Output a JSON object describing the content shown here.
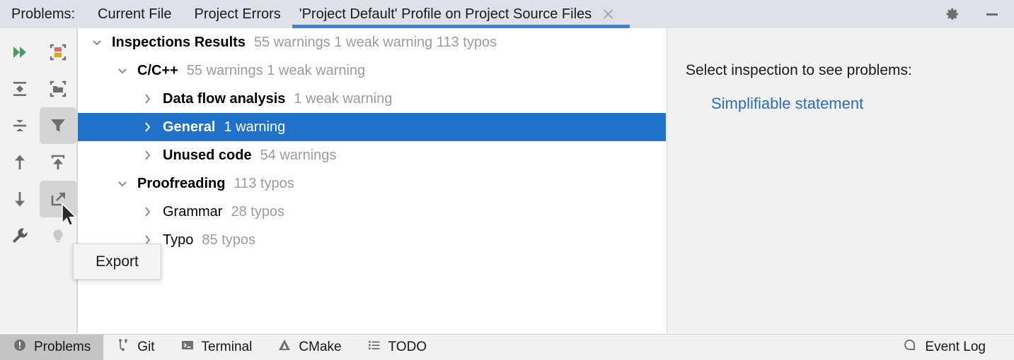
{
  "window": {
    "tab_group_label": "Problems:",
    "tabs": [
      {
        "label": "Current File",
        "active": false,
        "closable": false
      },
      {
        "label": "Project Errors",
        "active": false,
        "closable": false
      },
      {
        "label": "'Project Default' Profile on Project Source Files",
        "active": true,
        "closable": true
      }
    ],
    "accent_color": "#3f84cd",
    "titlebar_bg": "#dfe1e8",
    "controls": [
      {
        "name": "gear-icon",
        "title": "Settings"
      },
      {
        "name": "minimize-icon",
        "title": "Hide"
      }
    ]
  },
  "toolbar": {
    "buttons": [
      {
        "name": "rerun-icon",
        "title": "Rerun Inspection",
        "selected": false
      },
      {
        "name": "collapse-groups-icon",
        "title": "Group by Severity",
        "selected": false
      },
      {
        "name": "expand-all-icon",
        "title": "Expand All",
        "selected": false
      },
      {
        "name": "collapse-all-icon",
        "title": "Collapse All",
        "selected": false
      },
      {
        "name": "filter-icon",
        "title": "Filter",
        "selected": true
      },
      {
        "name": "previous-problem-icon",
        "title": "Previous Problem",
        "selected": false
      },
      {
        "name": "apply-fix-icon",
        "title": "Apply Quick Fix",
        "selected": false
      },
      {
        "name": "next-problem-icon",
        "title": "Next Problem",
        "selected": false
      },
      {
        "name": "export-icon",
        "title": "Export",
        "selected": true
      },
      {
        "name": "settings-wrench-icon",
        "title": "Edit Settings",
        "selected": false
      },
      {
        "name": "lightbulb-icon",
        "title": "Suggestions",
        "selected": false
      }
    ]
  },
  "tooltip": {
    "visible": true,
    "text": "Export"
  },
  "tree": {
    "rows": [
      {
        "indent": 0,
        "arrow": "down",
        "name": "Inspections Results",
        "bold": true,
        "count": "55 warnings 1 weak warning 113 typos",
        "selected": false
      },
      {
        "indent": 1,
        "arrow": "down",
        "name": "C/C++",
        "bold": true,
        "count": "55 warnings 1 weak warning",
        "selected": false
      },
      {
        "indent": 2,
        "arrow": "right",
        "name": "Data flow analysis",
        "bold": true,
        "count": "1 weak warning",
        "selected": false
      },
      {
        "indent": 2,
        "arrow": "right",
        "name": "General",
        "bold": true,
        "count": "1 warning",
        "selected": true
      },
      {
        "indent": 2,
        "arrow": "right",
        "name": "Unused code",
        "bold": true,
        "count": "54 warnings",
        "selected": false
      },
      {
        "indent": 1,
        "arrow": "down",
        "name": "Proofreading",
        "bold": true,
        "count": "113 typos",
        "selected": false
      },
      {
        "indent": 2,
        "arrow": "right",
        "name": "Grammar",
        "bold": false,
        "count": "28 typos",
        "selected": false
      },
      {
        "indent": 2,
        "arrow": "right",
        "name": "Typo",
        "bold": false,
        "count": "85 typos",
        "selected": false
      }
    ],
    "selection_color": "#1f72c8",
    "count_color": "#9b9b9b"
  },
  "details": {
    "prompt": "Select inspection to see problems:",
    "inspection_link": "Simplifiable statement",
    "link_color": "#2d6cb5"
  },
  "statusbar": {
    "items": [
      {
        "label": "Problems",
        "icon": "problems-icon",
        "active": true
      },
      {
        "label": "Git",
        "icon": "git-branch-icon",
        "active": false
      },
      {
        "label": "Terminal",
        "icon": "terminal-icon",
        "active": false
      },
      {
        "label": "CMake",
        "icon": "cmake-icon",
        "active": false
      },
      {
        "label": "TODO",
        "icon": "todo-list-icon",
        "active": false
      }
    ],
    "right": {
      "label": "Event Log",
      "icon": "event-log-icon"
    }
  }
}
